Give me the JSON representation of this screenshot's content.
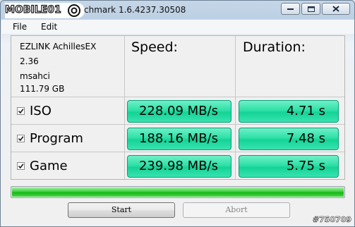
{
  "window": {
    "logo_text": "MOBILE01",
    "title": "chmark 1.6.4237.30508"
  },
  "menu": {
    "file": "File",
    "edit": "Edit"
  },
  "device": {
    "name": "EZLINK AchillesEX",
    "version": "2.36",
    "driver": "msahci",
    "capacity": "111.79 GB"
  },
  "headers": {
    "speed": "Speed:",
    "duration": "Duration:"
  },
  "rows": [
    {
      "label": "ISO",
      "checked": true,
      "speed": "228.09 MB/s",
      "duration": "4.71 s"
    },
    {
      "label": "Program",
      "checked": true,
      "speed": "188.16 MB/s",
      "duration": "7.48 s"
    },
    {
      "label": "Game",
      "checked": true,
      "speed": "239.98 MB/s",
      "duration": "5.75 s"
    }
  ],
  "progress": {
    "value_percent": 100
  },
  "buttons": {
    "start": "Start",
    "abort": "Abort"
  },
  "watermark": "#750709",
  "colors": {
    "result_green": "#2ee0a6",
    "progress_green": "#14b814"
  }
}
